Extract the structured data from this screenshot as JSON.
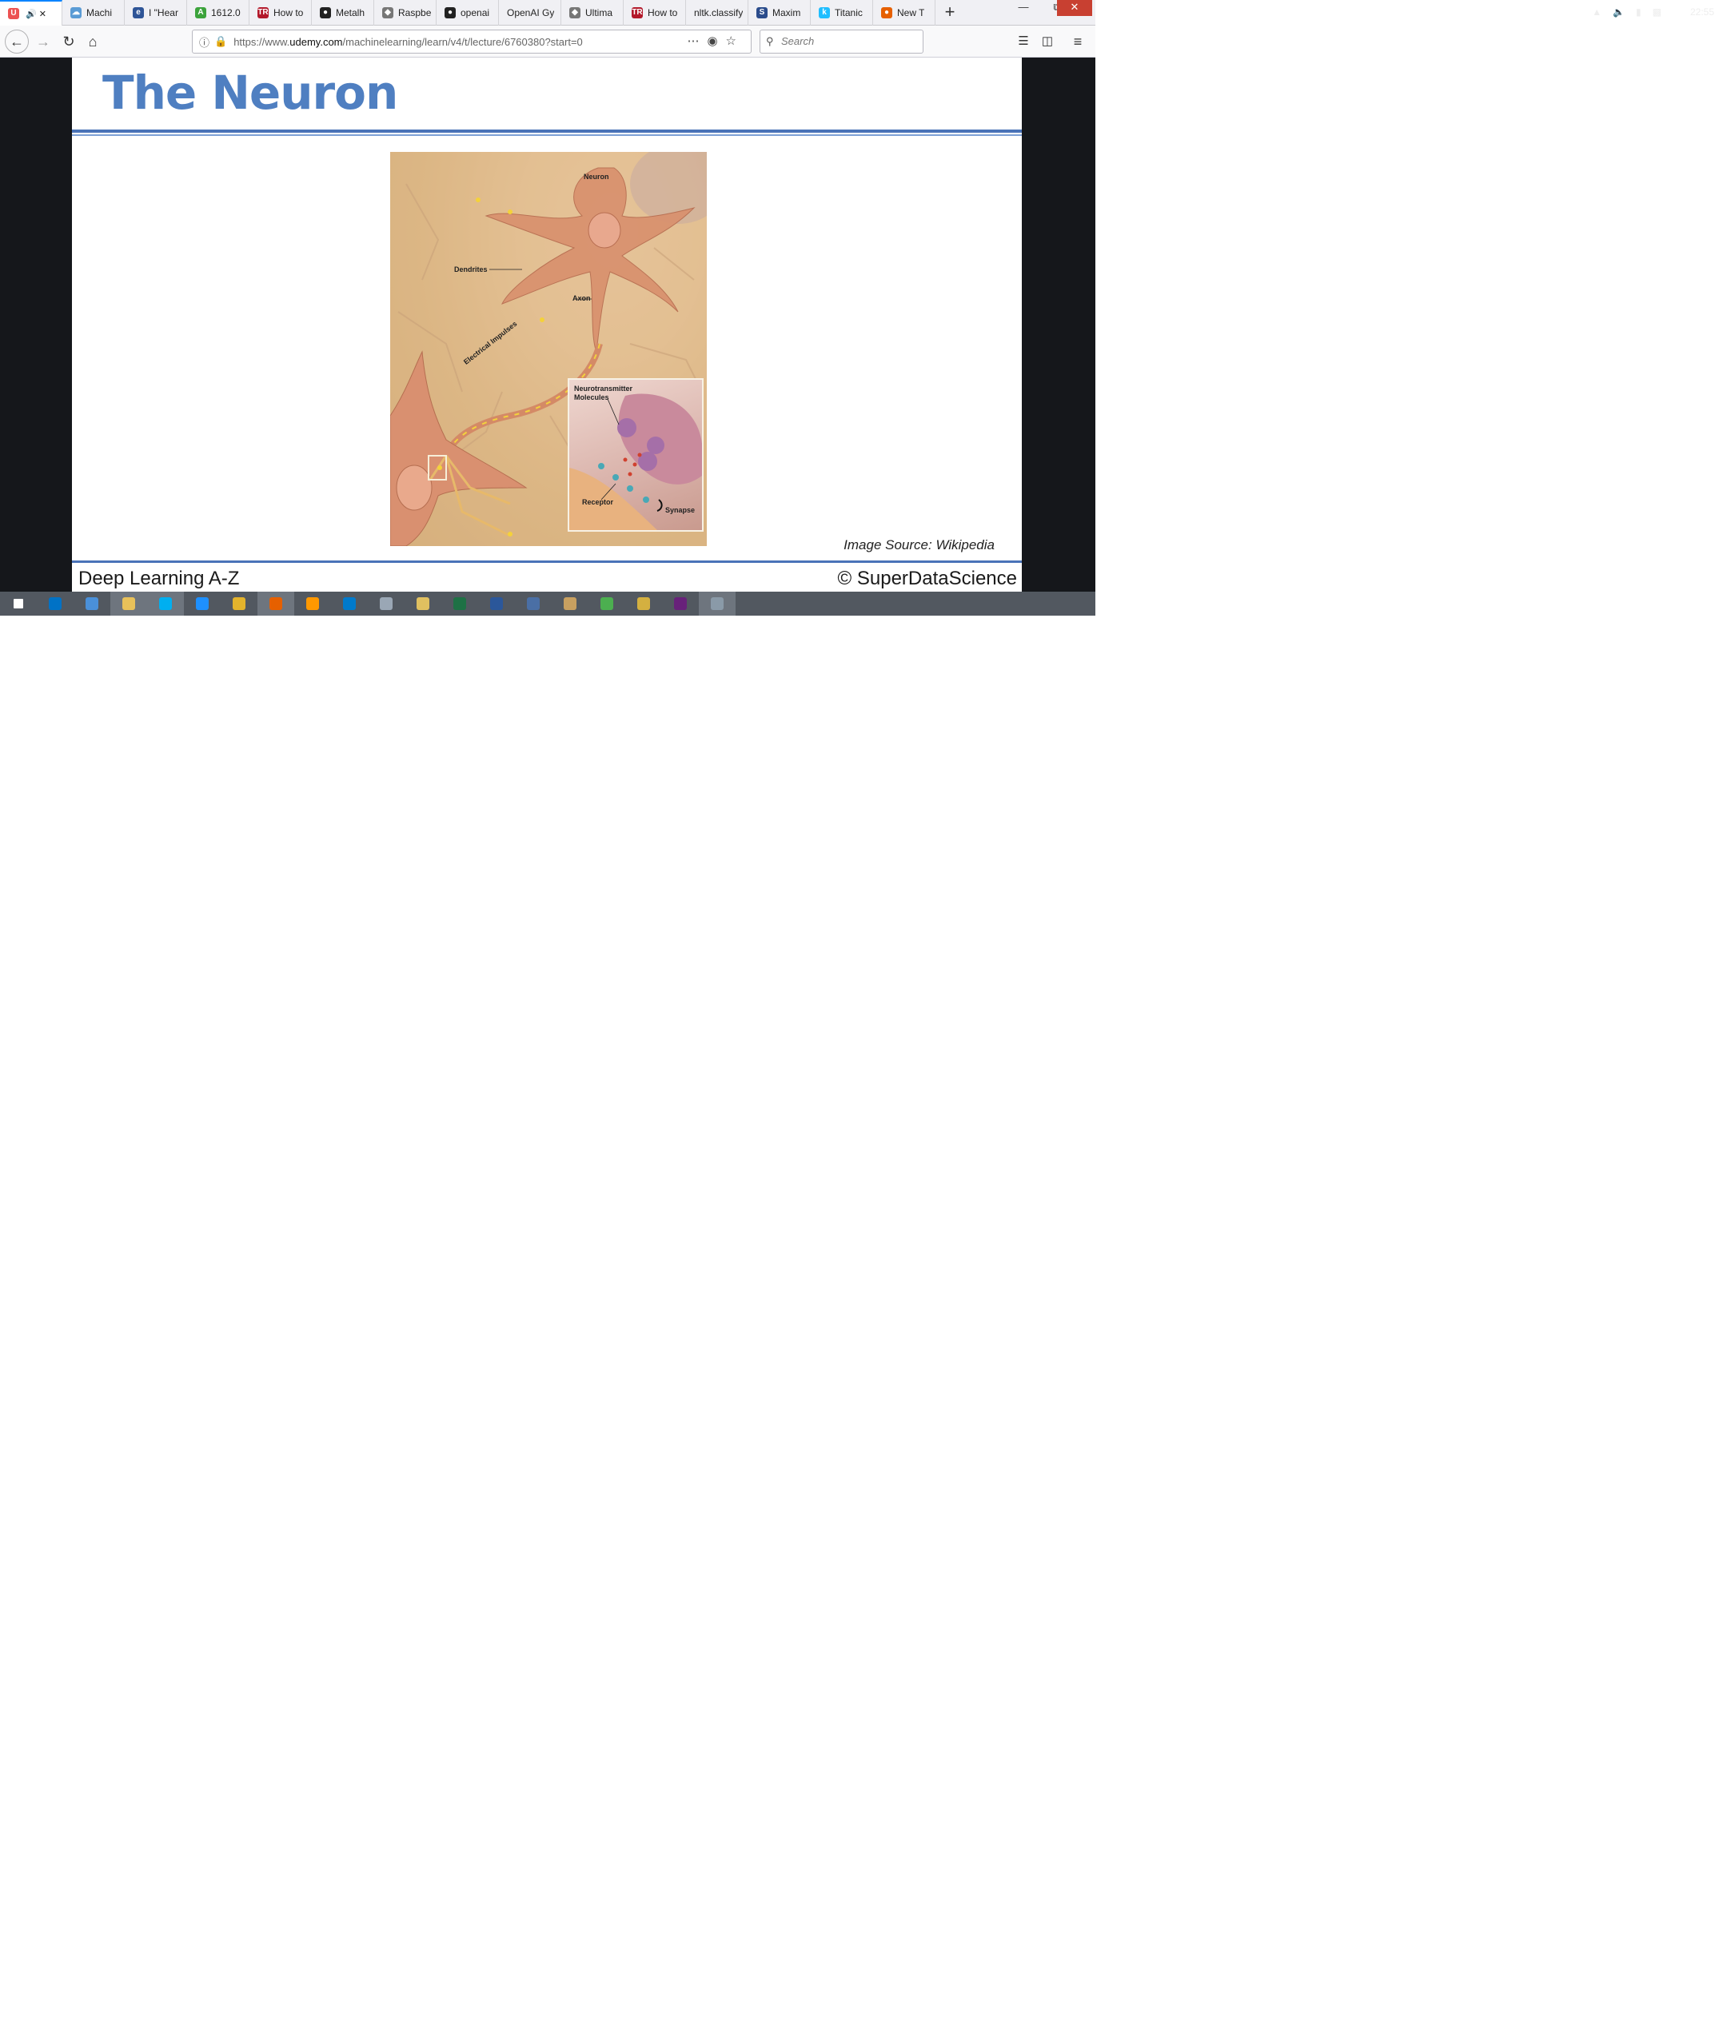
{
  "browser": {
    "tabs": [
      {
        "label": "",
        "favicon": "udemy-icon",
        "color": "#ec5252",
        "active": true
      },
      {
        "label": "Machi",
        "favicon": "cloud-icon",
        "color": "#5a9bd5"
      },
      {
        "label": "I \"Hear",
        "favicon": "ex-icon",
        "color": "#2f5597"
      },
      {
        "label": "1612.0",
        "favicon": "arxiv-icon",
        "color": "#3ca33c"
      },
      {
        "label": "How to",
        "favicon": "tr-icon",
        "color": "#b3192b"
      },
      {
        "label": "Metalh",
        "favicon": "github-icon",
        "color": "#222222"
      },
      {
        "label": "Raspbe",
        "favicon": "page-icon",
        "color": "#777777"
      },
      {
        "label": "openai",
        "favicon": "github-icon",
        "color": "#222222"
      },
      {
        "label": "OpenAI Gy",
        "favicon": "",
        "color": ""
      },
      {
        "label": "Ultima",
        "favicon": "page-icon",
        "color": "#777777"
      },
      {
        "label": "How to",
        "favicon": "tr-icon",
        "color": "#b3192b"
      },
      {
        "label": "nltk.classify",
        "favicon": "",
        "color": ""
      },
      {
        "label": "Maxim",
        "favicon": "s-icon",
        "color": "#2b4c8c"
      },
      {
        "label": "Titanic",
        "favicon": "k-icon",
        "color": "#20beff"
      },
      {
        "label": "New T",
        "favicon": "firefox-icon",
        "color": "#e66000"
      }
    ],
    "url_prefix": "https://www.",
    "url_host": "udemy.com",
    "url_path": "/machinelearning/learn/v4/t/lecture/6760380?start=0",
    "search_placeholder": "Search"
  },
  "slide": {
    "title": "The Neuron",
    "image_labels": {
      "neuron": "Neuron",
      "dendrites": "Dendrites",
      "axon": "Axon",
      "impulses": "Electrical Impulses",
      "neurotransmitter": "Neurotransmitter",
      "molecules": "Molecules",
      "receptor": "Receptor",
      "synapse": "Synapse"
    },
    "image_source": "Image Source: Wikipedia",
    "footer_left": "Deep Learning A-Z",
    "footer_right": "© SuperDataScience"
  },
  "taskbar": {
    "clock": "22:55",
    "apps": [
      {
        "name": "start-icon",
        "color": "#ffffff"
      },
      {
        "name": "outlook-icon",
        "color": "#0072c6"
      },
      {
        "name": "computer-icon",
        "color": "#4a90d9"
      },
      {
        "name": "explorer-icon",
        "color": "#e8c15a"
      },
      {
        "name": "skype-icon",
        "color": "#00aff0"
      },
      {
        "name": "ie-icon",
        "color": "#1e90ff"
      },
      {
        "name": "chrome-icon",
        "color": "#e3b32c"
      },
      {
        "name": "firefox-icon",
        "color": "#e66000"
      },
      {
        "name": "sublime-icon",
        "color": "#ff9800"
      },
      {
        "name": "vscode-icon",
        "color": "#007acc"
      },
      {
        "name": "printer-icon",
        "color": "#9aa7b5"
      },
      {
        "name": "tool-icon",
        "color": "#e0c060"
      },
      {
        "name": "excel-icon",
        "color": "#1e7145"
      },
      {
        "name": "word-icon",
        "color": "#2b579a"
      },
      {
        "name": "network-icon",
        "color": "#4a6fa5"
      },
      {
        "name": "paint-icon",
        "color": "#c8a060"
      },
      {
        "name": "chart-icon",
        "color": "#4caf50"
      },
      {
        "name": "app-icon",
        "color": "#d4b040"
      },
      {
        "name": "vs-icon",
        "color": "#68217a"
      },
      {
        "name": "settings-icon",
        "color": "#8a9aa8"
      }
    ]
  }
}
